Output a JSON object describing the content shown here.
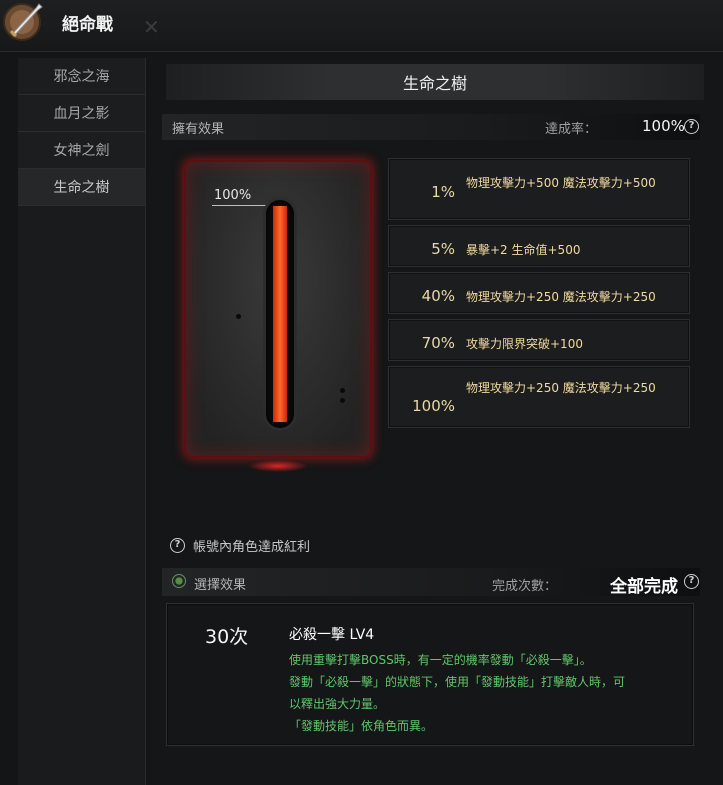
{
  "window": {
    "title": "絕命戰",
    "logo_icon": "sword-emblem-icon",
    "close_icon": "close-icon"
  },
  "sidebar": {
    "items": [
      {
        "label": "邪念之海"
      },
      {
        "label": "血月之影"
      },
      {
        "label": "女神之劍"
      },
      {
        "label": "生命之樹",
        "active": true
      }
    ]
  },
  "main": {
    "header": "生命之樹",
    "owned": {
      "label": "擁有效果",
      "rate_label": "達成率：",
      "rate_value": "100%"
    },
    "gauge": {
      "label": "100%",
      "fill": 1.0
    },
    "effects": [
      {
        "pct": "1%",
        "text": "物理攻擊力+500 魔法攻擊力+500"
      },
      {
        "pct": "5%",
        "text": "暴擊+2 生命值+500"
      },
      {
        "pct": "40%",
        "text": "物理攻擊力+250 魔法攻擊力+250"
      },
      {
        "pct": "70%",
        "text": "攻擊力限界突破+100"
      },
      {
        "pct": "100%",
        "text": "物理攻擊力+250 魔法攻擊力+250"
      }
    ],
    "account_bonus": "帳號內角色達成紅利",
    "select": {
      "label": "選擇效果",
      "count_label": "完成次數：",
      "count_value": "全部完成"
    },
    "skill": {
      "count": "30次",
      "name": "必殺一擊 LV4",
      "desc": [
        "使用重擊打擊BOSS時，有一定的機率發動「必殺一擊」。",
        "發動「必殺一擊」的狀態下，使用「發動技能」打擊敵人時，可",
        "以釋出強大力量。",
        "「發動技能」依角色而異。"
      ]
    }
  },
  "colors": {
    "accent_gold": "#f0d9a0",
    "skill_green": "#5fc76a",
    "gauge_red": "#ff4a1a"
  }
}
